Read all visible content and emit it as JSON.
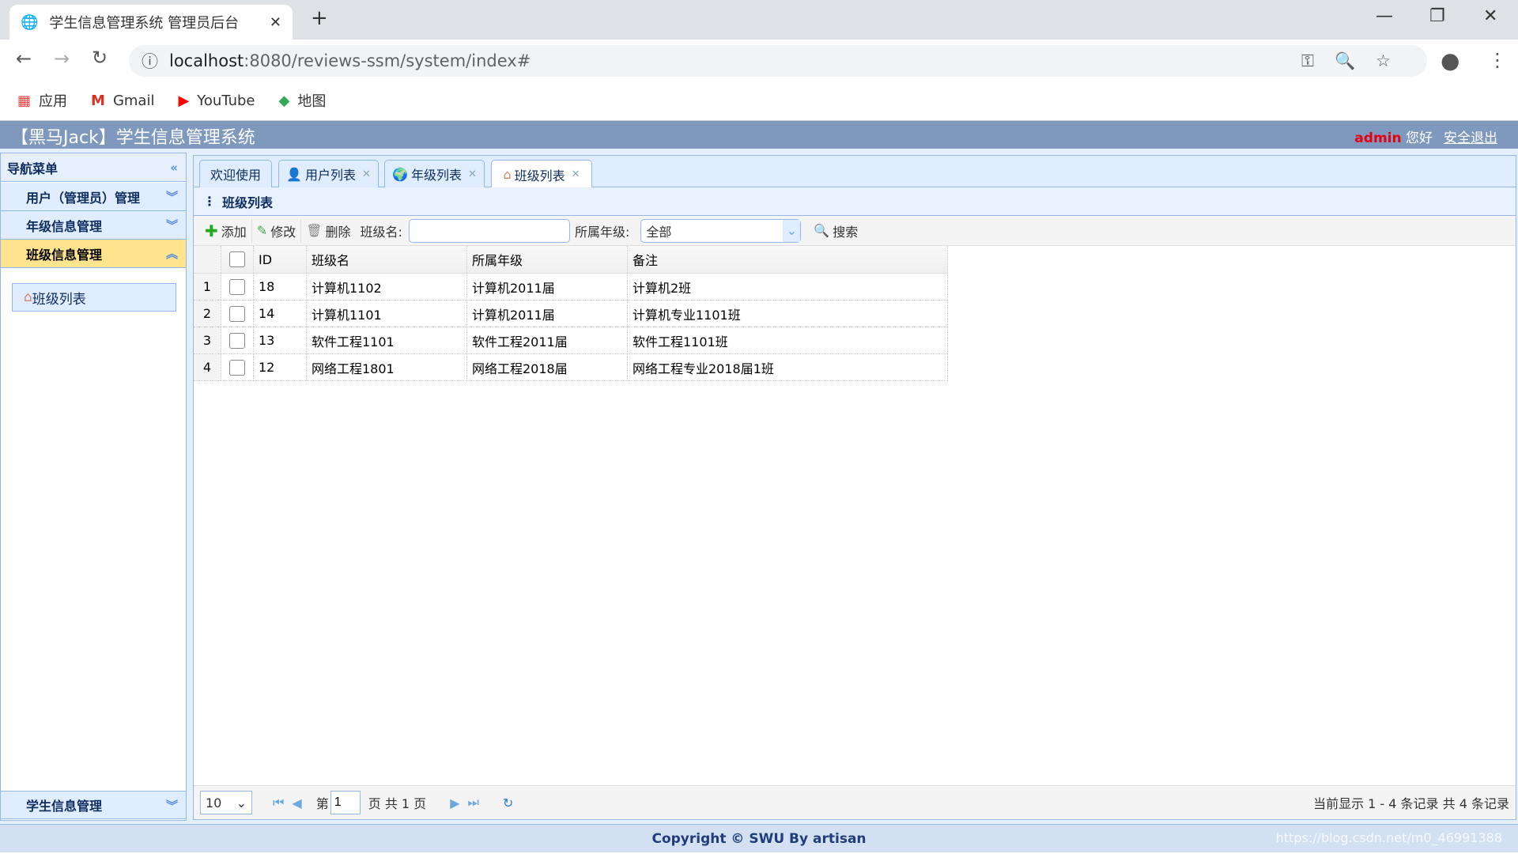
{
  "browser": {
    "tab_title": "学生信息管理系统 管理员后台",
    "url_host": "localhost",
    "url_rest": ":8080/reviews-ssm/system/index#",
    "bookmarks": [
      {
        "label": "应用",
        "icon": "apps-grid-icon"
      },
      {
        "label": "Gmail",
        "icon": "gmail-icon"
      },
      {
        "label": "YouTube",
        "icon": "youtube-icon"
      },
      {
        "label": "地图",
        "icon": "maps-icon"
      }
    ]
  },
  "header": {
    "title": "【黑马Jack】学生信息管理系统",
    "username": "admin",
    "greeting": "您好",
    "logout": "安全退出"
  },
  "sidebar": {
    "title": "导航菜单",
    "items": [
      {
        "label": "用户（管理员）管理"
      },
      {
        "label": "年级信息管理"
      },
      {
        "label": "班级信息管理",
        "active": true
      },
      {
        "label": "学生信息管理"
      }
    ],
    "subitems": [
      {
        "label": "班级列表"
      }
    ]
  },
  "tabs": [
    {
      "label": "欢迎使用"
    },
    {
      "label": "用户列表"
    },
    {
      "label": "年级列表"
    },
    {
      "label": "班级列表",
      "active": true
    }
  ],
  "panel": {
    "title": "班级列表"
  },
  "toolbar": {
    "add": "添加",
    "edit": "修改",
    "delete": "删除",
    "name_label": "班级名:",
    "name_value": "",
    "grade_label": "所属年级:",
    "grade_value": "全部",
    "search": "搜索"
  },
  "grid": {
    "columns": [
      "ID",
      "班级名",
      "所属年级",
      "备注"
    ],
    "rows": [
      [
        "1",
        "18",
        "计算机1102",
        "计算机2011届",
        "计算机2班"
      ],
      [
        "2",
        "14",
        "计算机1101",
        "计算机2011届",
        "计算机专业1101班"
      ],
      [
        "3",
        "13",
        "软件工程1101",
        "软件工程2011届",
        "软件工程1101班"
      ],
      [
        "4",
        "12",
        "网络工程1801",
        "网络工程2018届",
        "网络工程专业2018届1班"
      ]
    ]
  },
  "pager": {
    "page_size": "10",
    "page_prefix": "第",
    "page": "1",
    "page_suffix": "页 共 1 页",
    "info": "当前显示 1 - 4 条记录 共 4 条记录"
  },
  "footer": {
    "copyright": "Copyright © SWU By artisan",
    "watermark": "https://blog.csdn.net/m0_46991388"
  },
  "colors": {
    "header_bg": "#7f99be",
    "active_nav": "#ffe48d",
    "border": "#95b8e7",
    "admin": "#e60012"
  }
}
